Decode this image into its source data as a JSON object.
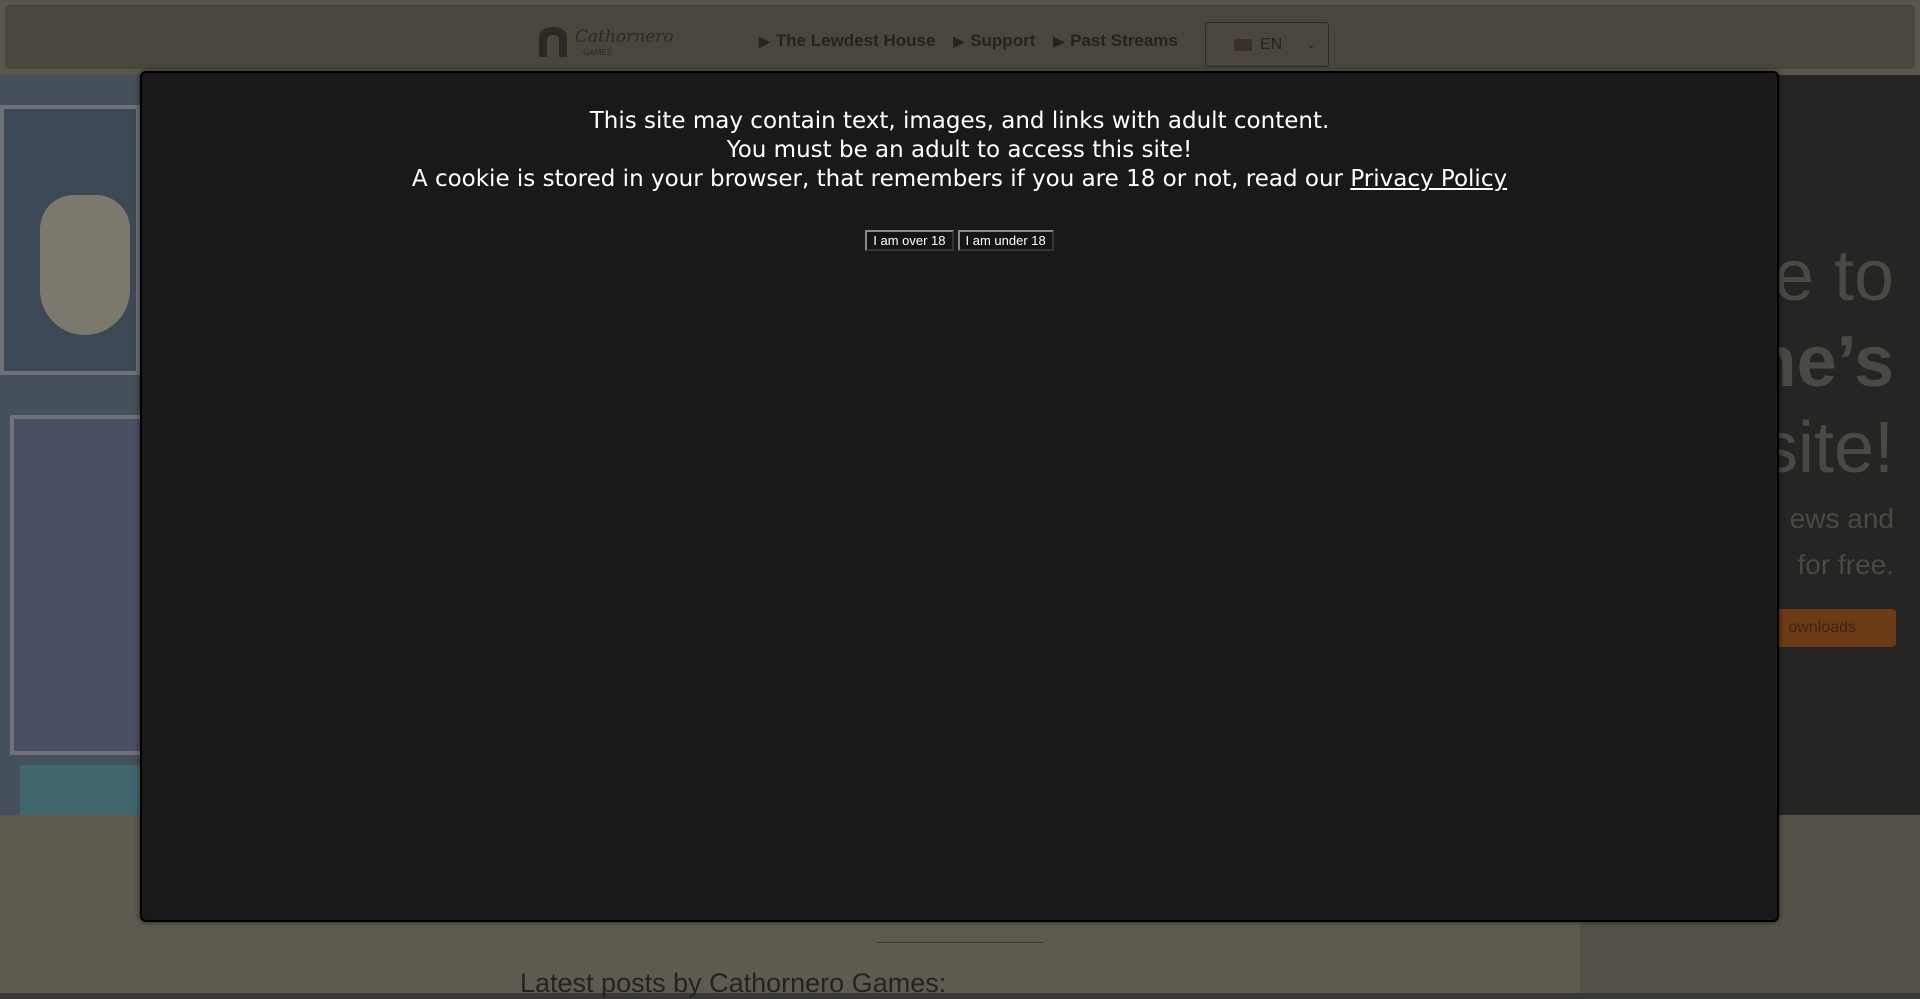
{
  "header": {
    "logo_text": "Cathornero",
    "logo_sub": "GAMES",
    "nav": [
      {
        "label": "The Lewdest House"
      },
      {
        "label": "Support"
      },
      {
        "label": "Past Streams"
      }
    ],
    "language": "EN"
  },
  "hero": {
    "line1": "e to",
    "line2": "ne’s",
    "line3": "site!",
    "line4": "ews and",
    "line5": "for free.",
    "button": "ownloads"
  },
  "latest_heading": "Latest posts by Cathornero Games:",
  "modal": {
    "line1": "This site may contain text, images, and links with adult content.",
    "line2": "You must be an adult to access this site!",
    "line3_prefix": "A cookie is stored in your browser, that remembers if you are 18 or not, read our",
    "privacy_link": "Privacy Policy",
    "over_button": "I am over 18",
    "under_button": "I am under 18"
  }
}
